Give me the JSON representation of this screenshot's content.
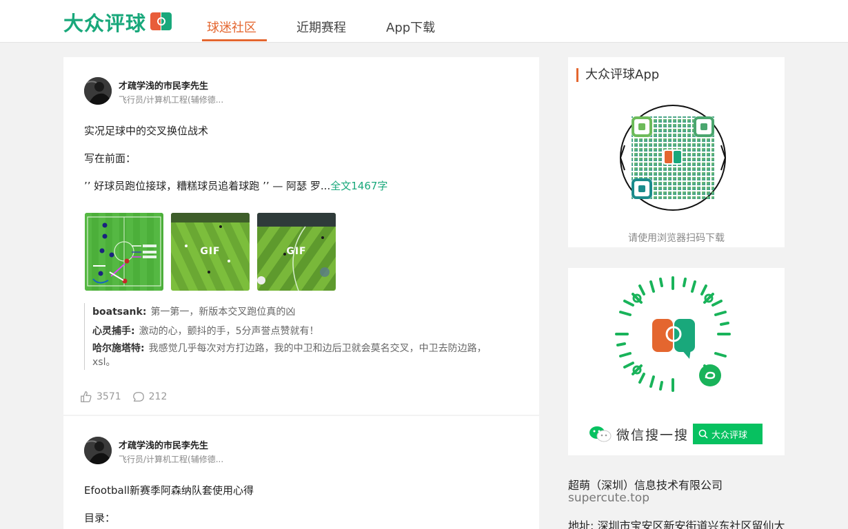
{
  "header": {
    "logo_text": "大众评球",
    "nav": [
      {
        "label": "球迷社区",
        "active": true
      },
      {
        "label": "近期赛程",
        "active": false
      },
      {
        "label": "App下载",
        "active": false
      }
    ],
    "accent": "#e4662f",
    "brand": "#19a87b"
  },
  "feed": {
    "posts": [
      {
        "author": "才疏学浅的市民李先生",
        "author_sub": "飞行员/计算机工程(辅修德...",
        "title": "实况足球中的交叉换位战术",
        "lines": [
          "写在前面：",
          "’’ 好球员跑位接球，糟糕球员追着球跑 ’’ — 阿瑟 罗..."
        ],
        "read_more": "全文1467字",
        "images": [
          {
            "kind": "tactics-diagram"
          },
          {
            "kind": "gif",
            "label": "GIF"
          },
          {
            "kind": "gif",
            "label": "GIF"
          }
        ],
        "comments": [
          {
            "user": "boatsank:",
            "text": "第一第一，新版本交叉跑位真的凶"
          },
          {
            "user": "心灵捕手:",
            "text": "激动的心，颤抖的手，5分声誉点赞就有！"
          },
          {
            "user": "哈尔施塔特:",
            "text": "我感觉几乎每次对方打边路，我的中卫和边后卫就会莫名交叉，中卫去防边路，xsl。"
          }
        ],
        "likes": "3571",
        "comment_count": "212"
      },
      {
        "author": "才疏学浅的市民李先生",
        "author_sub": "飞行员/计算机工程(辅修德...",
        "title": "Efootball新赛季阿森纳队套使用心得",
        "lines": [
          "目录："
        ]
      }
    ]
  },
  "sidebar": {
    "app_title": "大众评球App",
    "qr_caption": "请使用浏览器扫码下载",
    "wechat_search_label": "微信搜一搜",
    "wechat_search_value": "大众评球",
    "company": "超萌（深圳）信息技术有限公司",
    "domain": "supercute.top",
    "address": "地址: 深圳市宝安区新安街道兴东社区留仙大"
  },
  "icons": {
    "like": "thumbs-up-icon",
    "comment": "comment-bubble-icon",
    "search": "search-icon",
    "wechat": "wechat-icon"
  }
}
